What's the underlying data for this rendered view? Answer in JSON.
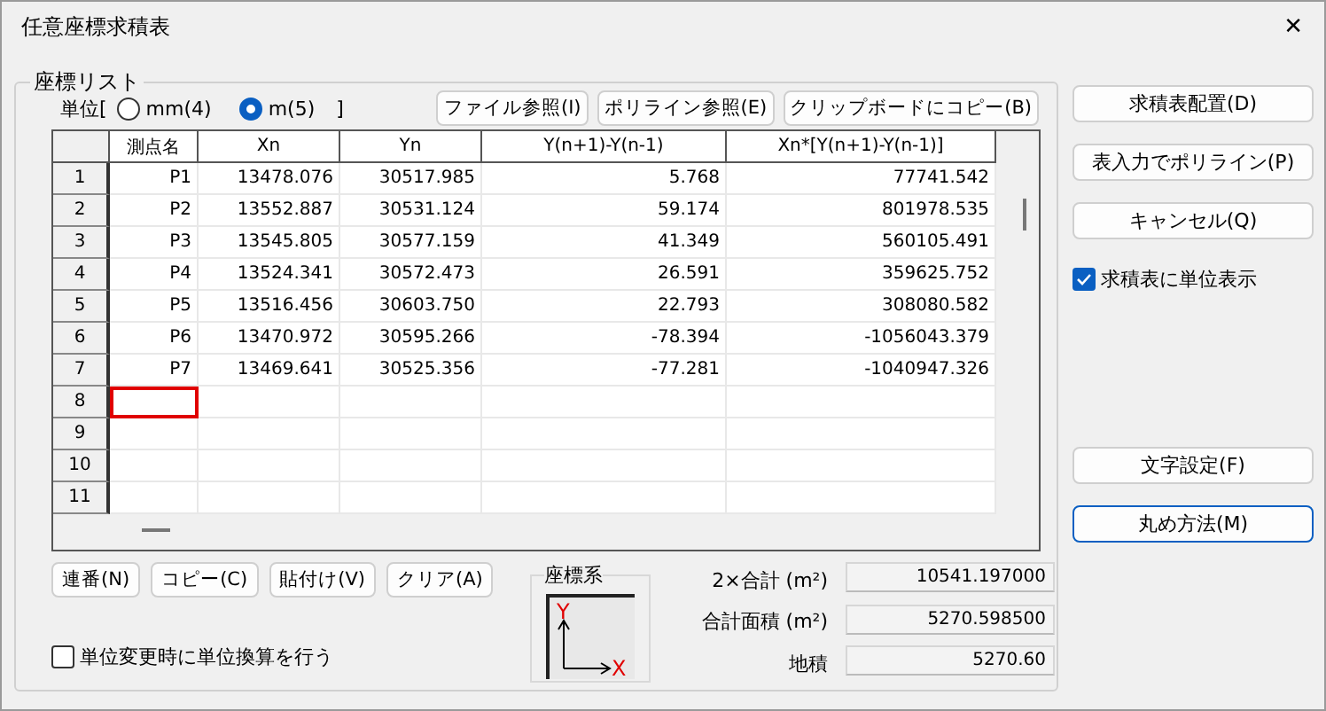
{
  "window": {
    "title": "任意座標求積表",
    "close": "✕"
  },
  "group": {
    "label": "座標リスト"
  },
  "units": {
    "prefix": "単位[",
    "suffix": "]",
    "options": [
      {
        "label": "mm(4)",
        "selected": false
      },
      {
        "label": "m(5)",
        "selected": true
      }
    ]
  },
  "top_buttons": [
    "ファイル参照(I)",
    "ポリライン参照(E)",
    "クリップボードにコピー(B)"
  ],
  "table": {
    "columns": [
      "測点名",
      "Xn",
      "Yn",
      "Y(n+1)-Y(n-1)",
      "Xn*[Y(n+1)-Y(n-1)]"
    ],
    "rows": [
      {
        "number": "1",
        "current": false,
        "cells": [
          "P1",
          "13478.076",
          "30517.985",
          "5.768",
          "77741.542"
        ]
      },
      {
        "number": "2",
        "current": false,
        "cells": [
          "P2",
          "13552.887",
          "30531.124",
          "59.174",
          "801978.535"
        ]
      },
      {
        "number": "3",
        "current": false,
        "cells": [
          "P3",
          "13545.805",
          "30577.159",
          "41.349",
          "560105.491"
        ]
      },
      {
        "number": "4",
        "current": false,
        "cells": [
          "P4",
          "13524.341",
          "30572.473",
          "26.591",
          "359625.752"
        ]
      },
      {
        "number": "5",
        "current": false,
        "cells": [
          "P5",
          "13516.456",
          "30603.750",
          "22.793",
          "308080.582"
        ]
      },
      {
        "number": "6",
        "current": false,
        "cells": [
          "P6",
          "13470.972",
          "30595.266",
          "-78.394",
          "-1056043.379"
        ]
      },
      {
        "number": "7",
        "current": false,
        "cells": [
          "P7",
          "13469.641",
          "30525.356",
          "-77.281",
          "-1040947.326"
        ]
      },
      {
        "number": "8",
        "current": true,
        "cells": []
      },
      {
        "number": "9",
        "current": false,
        "cells": []
      },
      {
        "number": "10",
        "current": false,
        "cells": []
      },
      {
        "number": "11",
        "current": false,
        "cells": []
      }
    ]
  },
  "bottom_buttons": [
    "連番(N)",
    "コピー(C)",
    "貼付け(V)",
    "クリア(A)"
  ],
  "coordinate_system": {
    "label": "座標系",
    "y_axis": "Y",
    "x_axis": "X"
  },
  "totals": [
    {
      "label": "2×合計 (m²)",
      "value": "10541.197000"
    },
    {
      "label": "合計面積 (m²)",
      "value": "5270.598500"
    },
    {
      "label": "地積",
      "value": "5270.60"
    }
  ],
  "unit_conversion": {
    "label": "単位変更時に単位換算を行う",
    "checked": false
  },
  "side_buttons": [
    {
      "label": "求積表配置(D)",
      "focused": false
    },
    {
      "label": "表入力でポリライン(P)",
      "focused": false
    },
    {
      "label": "キャンセル(Q)",
      "focused": false
    }
  ],
  "show_units": {
    "label": "求積表に単位表示",
    "checked": true
  },
  "side_buttons_bottom": [
    {
      "label": "文字設定(F)",
      "focused": false
    },
    {
      "label": "丸め方法(M)",
      "focused": true
    }
  ]
}
